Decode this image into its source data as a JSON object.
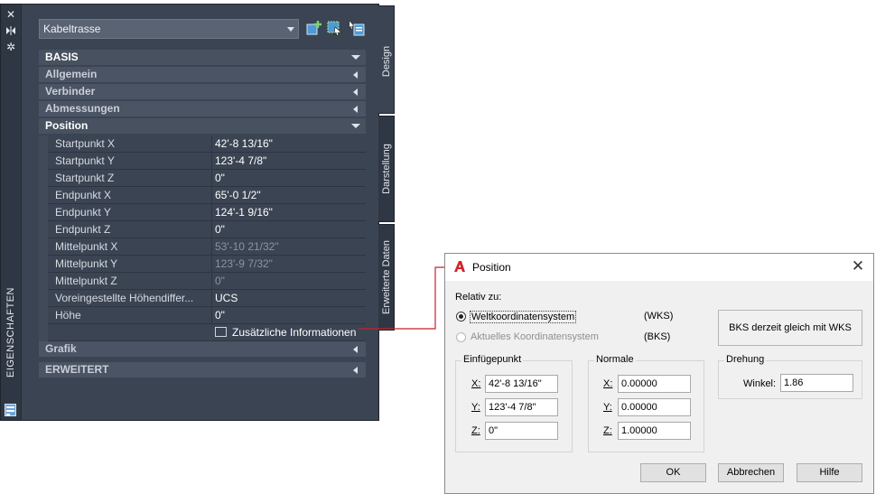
{
  "palette": {
    "title": "EIGENSCHAFTEN",
    "strip_buttons": [
      "close-icon",
      "autohide-icon",
      "properties-settings-icon"
    ],
    "type_selector": "Kabeltrasse",
    "toolbar_icons": [
      "add-selection-icon",
      "quick-select-icon",
      "select-objects-icon"
    ],
    "categories": {
      "basis": "BASIS",
      "allgemein": "Allgemein",
      "verbinder": "Verbinder",
      "abmessungen": "Abmessungen",
      "position": "Position",
      "grafik": "Grafik",
      "erweitert": "ERWEITERT"
    },
    "position_props": [
      {
        "name": "Startpunkt X",
        "value": "42'-8 13/16\""
      },
      {
        "name": "Startpunkt Y",
        "value": "123'-4 7/8\""
      },
      {
        "name": "Startpunkt Z",
        "value": "0\""
      },
      {
        "name": "Endpunkt X",
        "value": "65'-0 1/2\""
      },
      {
        "name": "Endpunkt Y",
        "value": "124'-1 9/16\""
      },
      {
        "name": "Endpunkt Z",
        "value": "0\""
      },
      {
        "name": "Mittelpunkt X",
        "value": "53'-10 21/32\""
      },
      {
        "name": "Mittelpunkt Y",
        "value": "123'-9 7/32\""
      },
      {
        "name": "Mittelpunkt Z",
        "value": "0\""
      },
      {
        "name": "Voreingestellte  Höhendiffer...",
        "value": "UCS"
      },
      {
        "name": "Höhe",
        "value": "0\""
      }
    ],
    "more_info": "Zusätzliche Informationen",
    "tabs": {
      "design": "Design",
      "darstellung": "Darstellung",
      "erweiterte": "Erweiterte Daten"
    }
  },
  "dialog": {
    "title": "Position",
    "relativ_label": "Relativ zu:",
    "radio_world": "Weltkoordinatensystem",
    "radio_world_abbr": "(WKS)",
    "radio_current": "Aktuelles Koordinatensystem",
    "radio_current_abbr": "(BKS)",
    "bks_info": "BKS derzeit gleich mit WKS",
    "einfuegepunkt": {
      "title": "Einfügepunkt",
      "x_label": "X:",
      "y_label": "Y:",
      "z_label": "Z:",
      "x": "42'-8 13/16\"",
      "y": "123'-4 7/8\"",
      "z": "0\""
    },
    "normale": {
      "title": "Normale",
      "x_label": "X:",
      "y_label": "Y:",
      "z_label": "Z:",
      "x": "0.00000",
      "y": "0.00000",
      "z": "1.00000"
    },
    "drehung": {
      "title": "Drehung",
      "winkel_label": "Winkel:",
      "winkel": "1.86"
    },
    "buttons": {
      "ok": "OK",
      "cancel": "Abbrechen",
      "help": "Hilfe"
    }
  }
}
